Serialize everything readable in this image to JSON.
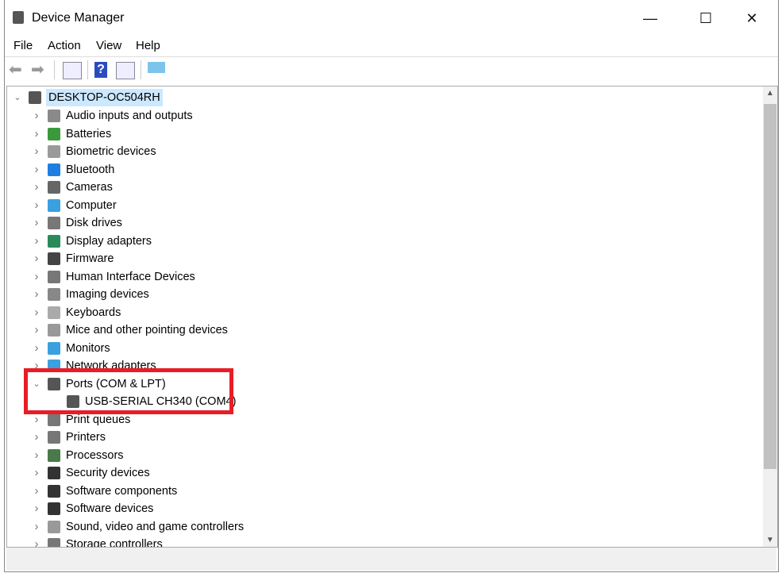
{
  "window": {
    "title": "Device Manager",
    "minimize": "—",
    "maximize": "☐",
    "close": "✕"
  },
  "menu": [
    "File",
    "Action",
    "View",
    "Help"
  ],
  "toolbar": [
    "back-icon",
    "forward-icon",
    "properties-icon",
    "help-icon",
    "update-driver-icon",
    "scan-hardware-icon"
  ],
  "tree": {
    "root": "DESKTOP-OC504RH",
    "items": [
      {
        "label": "Audio inputs and outputs",
        "color": "#8a8a8a"
      },
      {
        "label": "Batteries",
        "color": "#3a9a3a"
      },
      {
        "label": "Biometric devices",
        "color": "#9a9a9a"
      },
      {
        "label": "Bluetooth",
        "color": "#1e7fe0"
      },
      {
        "label": "Cameras",
        "color": "#666666"
      },
      {
        "label": "Computer",
        "color": "#3aa0e0"
      },
      {
        "label": "Disk drives",
        "color": "#777777"
      },
      {
        "label": "Display adapters",
        "color": "#2a8a5a"
      },
      {
        "label": "Firmware",
        "color": "#444444"
      },
      {
        "label": "Human Interface Devices",
        "color": "#777777"
      },
      {
        "label": "Imaging devices",
        "color": "#888888"
      },
      {
        "label": "Keyboards",
        "color": "#aaaaaa"
      },
      {
        "label": "Mice and other pointing devices",
        "color": "#999999"
      },
      {
        "label": "Monitors",
        "color": "#3aa0e0"
      },
      {
        "label": "Network adapters",
        "color": "#3aa0e0"
      },
      {
        "label": "Ports (COM & LPT)",
        "color": "#555555",
        "expanded": true
      },
      {
        "label": "USB-SERIAL CH340 (COM4)",
        "color": "#555555",
        "child": true
      },
      {
        "label": "Print queues",
        "color": "#777777"
      },
      {
        "label": "Printers",
        "color": "#777777"
      },
      {
        "label": "Processors",
        "color": "#4a7a4a"
      },
      {
        "label": "Security devices",
        "color": "#333333"
      },
      {
        "label": "Software components",
        "color": "#333333"
      },
      {
        "label": "Software devices",
        "color": "#333333"
      },
      {
        "label": "Sound, video and game controllers",
        "color": "#999999"
      },
      {
        "label": "Storage controllers",
        "color": "#777777"
      }
    ]
  },
  "highlight_color": "#e81d25"
}
